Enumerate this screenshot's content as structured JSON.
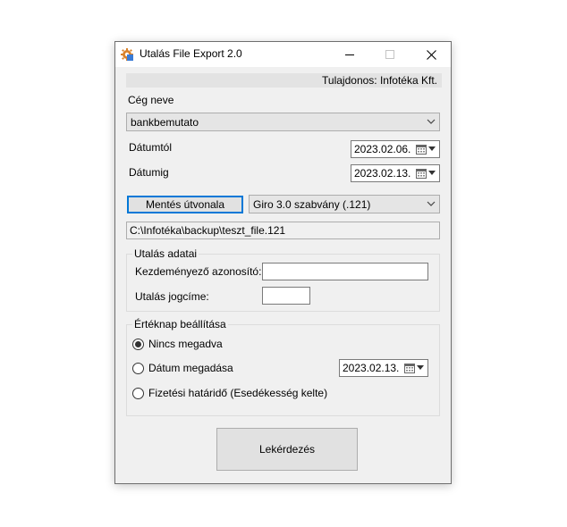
{
  "window": {
    "title": "Utalás File Export 2.0"
  },
  "owner": {
    "text": "Tulajdonos: Infotéka Kft."
  },
  "company": {
    "label": "Cég neve",
    "selected": "bankbemutato"
  },
  "date_from": {
    "label": "Dátumtól",
    "value": "2023.02.06."
  },
  "date_to": {
    "label": "Dátumig",
    "value": "2023.02.13."
  },
  "save": {
    "button_label": "Mentés útvonala",
    "format_selected": "Giro 3.0 szabvány (.121)",
    "path": "C:\\Infotéka\\backup\\teszt_file.121"
  },
  "transfer": {
    "group_title": "Utalás adatai",
    "initiator_label": "Kezdeményező azonosító:",
    "initiator_value": "",
    "reason_label": "Utalás jogcíme:",
    "reason_value": ""
  },
  "value_date": {
    "group_title": "Értéknap beállítása",
    "options": [
      {
        "label": "Nincs megadva",
        "selected": true
      },
      {
        "label": "Dátum megadása",
        "selected": false
      },
      {
        "label": "Fizetési határidő (Esedékesség kelte)",
        "selected": false
      }
    ],
    "date_value": "2023.02.13."
  },
  "actions": {
    "query_label": "Lekérdezés"
  },
  "colors": {
    "focus_accent": "#0078d7",
    "window_bg": "#f0f0f0"
  }
}
